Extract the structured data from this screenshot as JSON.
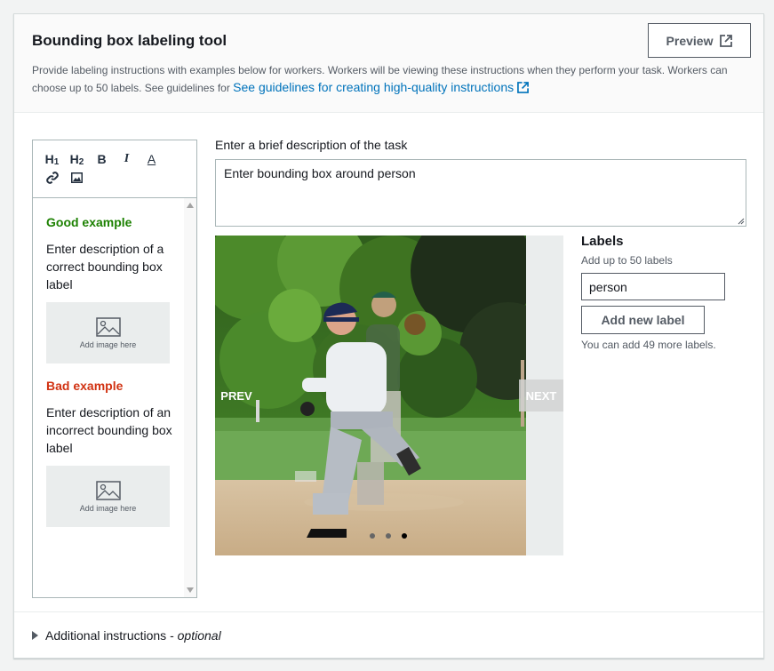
{
  "header": {
    "title": "Bounding box labeling tool",
    "preview_label": "Preview",
    "description": "Provide labeling instructions with examples below for workers. Workers will be viewing these instructions when they perform your task. Workers can choose up to 50 labels. See guidelines for ",
    "guidelines_link": "See guidelines for creating high-quality instructions"
  },
  "editor": {
    "toolbar": [
      "H1",
      "H2",
      "B",
      "I",
      "A",
      "link",
      "image"
    ],
    "good_heading": "Good example",
    "good_text": "Enter description of a correct bounding box label",
    "bad_heading": "Bad example",
    "bad_text": "Enter description of an incorrect bounding box label",
    "add_image": "Add image here"
  },
  "task": {
    "label": "Enter a brief description of the task",
    "value": "Enter bounding box around person"
  },
  "carousel": {
    "prev": "PREV",
    "next": "NEXT",
    "slide_count": 3,
    "active_slide": 3
  },
  "labels": {
    "title": "Labels",
    "subtitle": "Add up to 50 labels",
    "input_value": "person",
    "add_button": "Add new label",
    "remaining": "You can add 49 more labels."
  },
  "footer": {
    "additional": "Additional instructions",
    "separator": " - ",
    "optional": "optional"
  },
  "colors": {
    "good": "#1d8102",
    "bad": "#d13212",
    "link": "#0073bb"
  },
  "icons": [
    "external-link-icon",
    "heading-1-icon",
    "heading-2-icon",
    "bold-icon",
    "italic-icon",
    "text-color-icon",
    "link-icon",
    "image-icon",
    "image-placeholder-icon",
    "caret-right-icon"
  ]
}
